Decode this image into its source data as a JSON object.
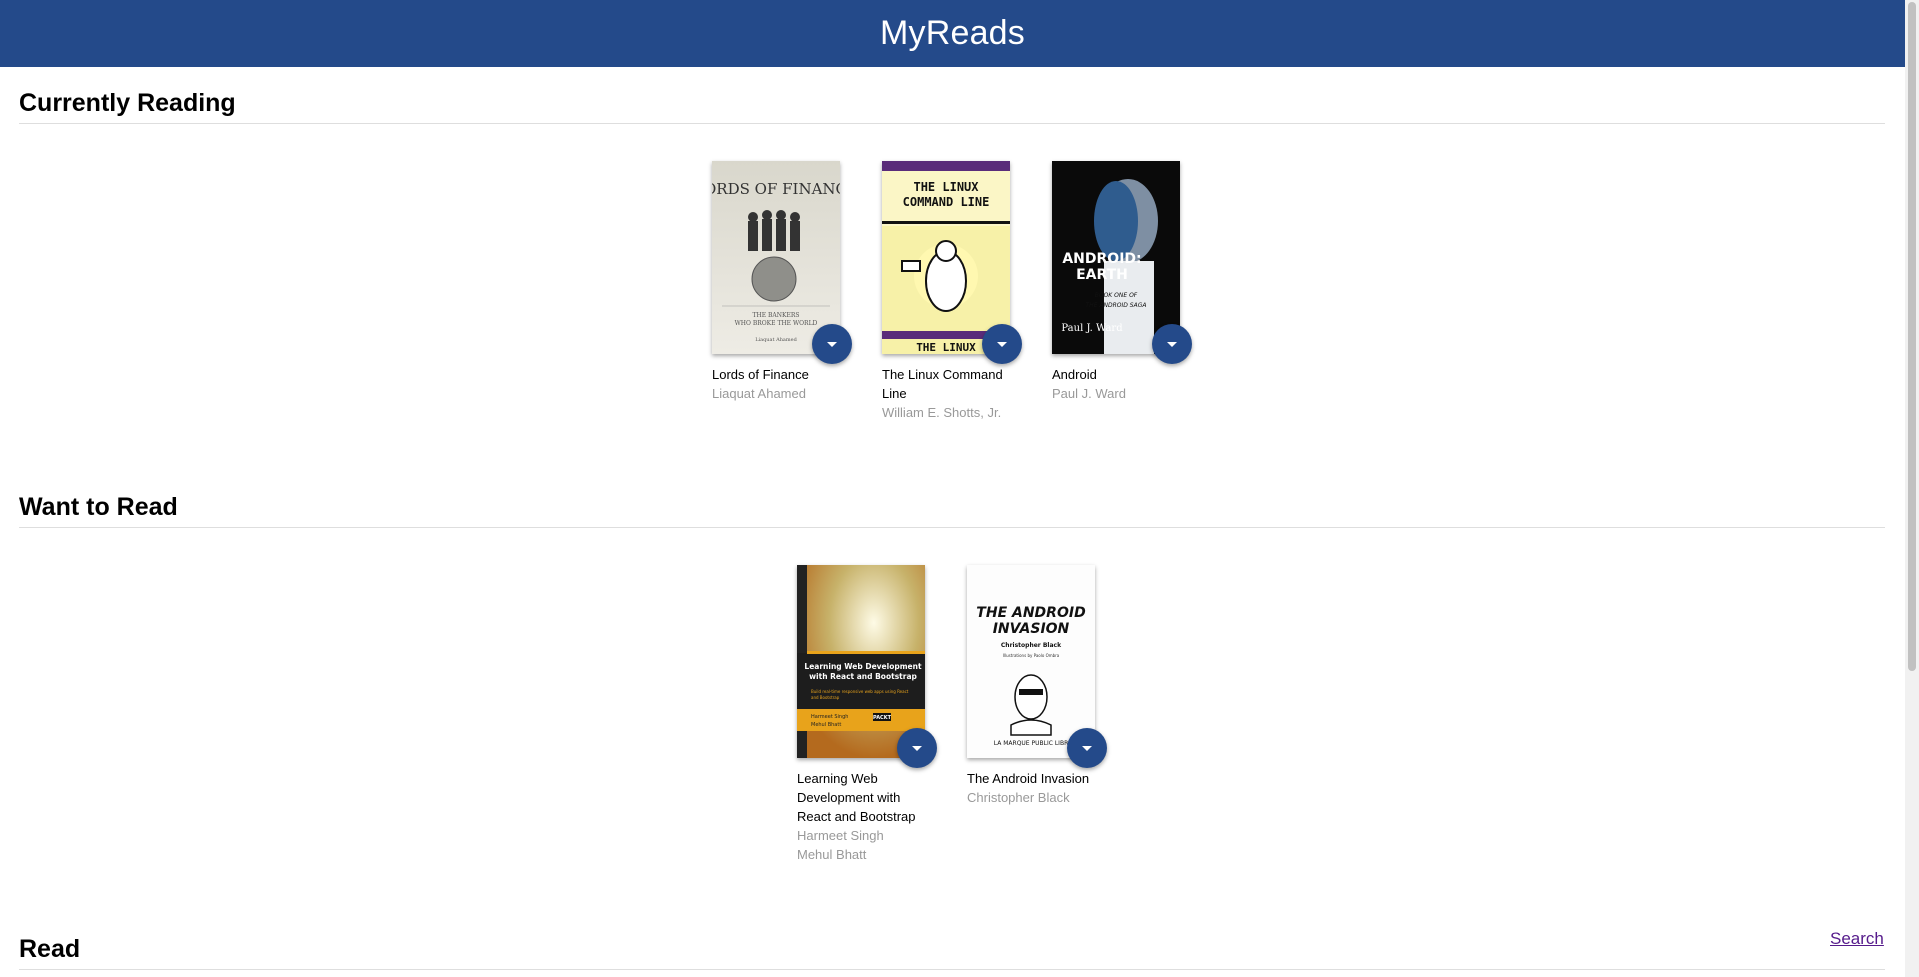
{
  "app": {
    "title": "MyReads"
  },
  "shelves": [
    {
      "title": "Currently Reading",
      "books": [
        {
          "title": "Lords of Finance",
          "authors": [
            "Liaquat Ahamed"
          ],
          "cover_text": "LORDS OF FINANCE"
        },
        {
          "title": "The Linux Command Line",
          "authors": [
            "William E. Shotts, Jr."
          ],
          "cover_text": "THE LINUX COMMAND LINE"
        },
        {
          "title": "Android",
          "authors": [
            "Paul J. Ward"
          ],
          "cover_text": "ANDROID: EARTH"
        }
      ]
    },
    {
      "title": "Want to Read",
      "books": [
        {
          "title": "Learning Web Development with React and Bootstrap",
          "authors": [
            "Harmeet Singh",
            "Mehul Bhatt"
          ],
          "cover_text": "Learning Web Development with React and Bootstrap"
        },
        {
          "title": "The Android Invasion",
          "authors": [
            "Christopher Black"
          ],
          "cover_text": "THE ANDROID INVASION"
        }
      ]
    },
    {
      "title": "Read",
      "books": []
    }
  ],
  "search": {
    "label": "Search"
  },
  "icons": {
    "shelf_changer": "caret-down-icon"
  },
  "colors": {
    "header_bg": "#244a8a",
    "link": "#551a8b",
    "author_text": "#999999"
  }
}
